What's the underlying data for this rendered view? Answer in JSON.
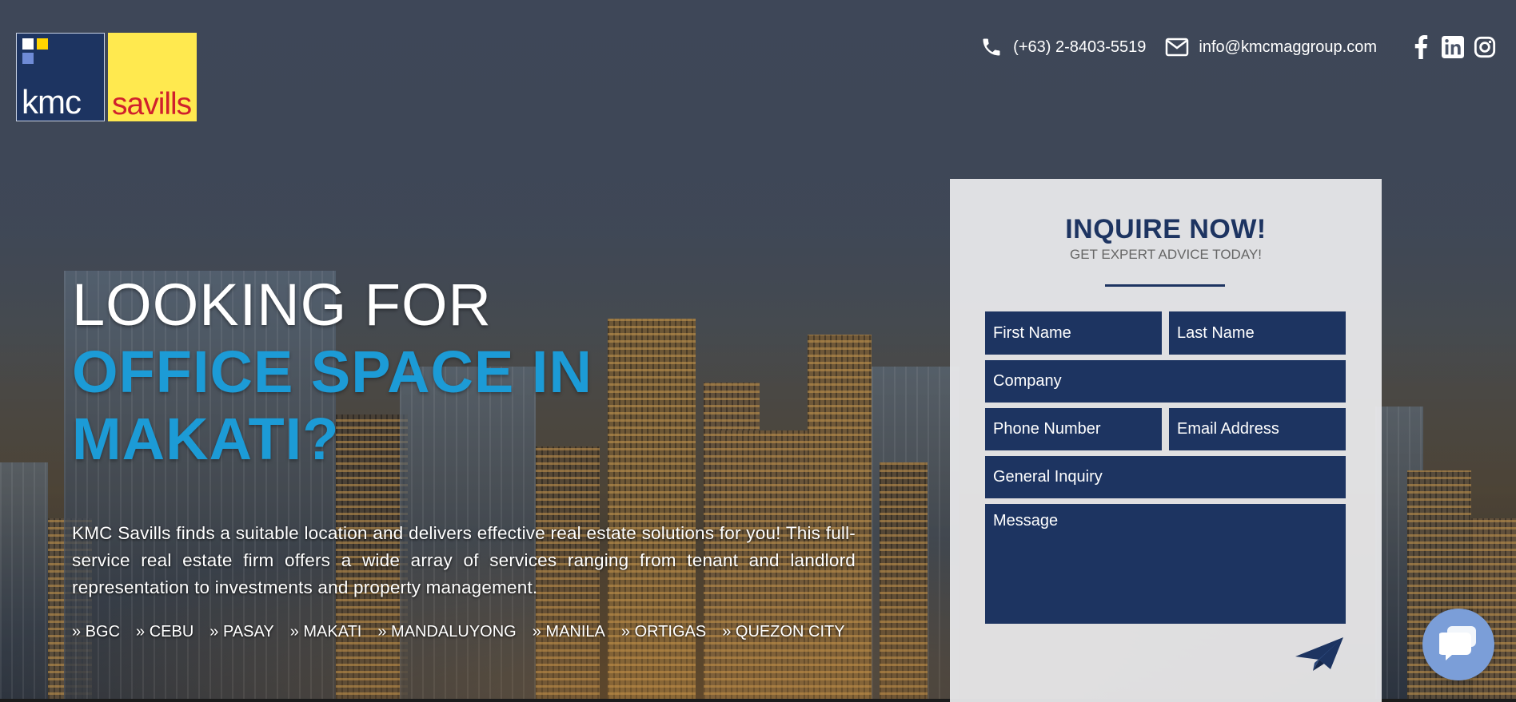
{
  "logo": {
    "kmc_text": "kmc",
    "savills_text": "savills"
  },
  "header": {
    "phone": "(+63) 2-8403-5519",
    "email": "info@kmcmaggroup.com",
    "social_icons": [
      "facebook-icon",
      "linkedin-icon",
      "instagram-icon"
    ]
  },
  "hero": {
    "line1": "LOOKING FOR",
    "line2a": "OFFICE SPACE IN",
    "line2b": "MAKATI?",
    "description": "KMC Savills finds a suitable location and delivers effective real estate solutions for you! This full-service real estate firm offers a wide array of services ranging from tenant and landlord representation to investments and property management.",
    "locations": [
      "» BGC",
      "» CEBU",
      "» PASAY",
      "» MAKATI",
      "» MANDALUYONG",
      "» MANILA",
      "» ORTIGAS",
      "» QUEZON CITY"
    ]
  },
  "form": {
    "title": "INQUIRE NOW!",
    "subtitle": "GET EXPERT ADVICE TODAY!",
    "first_name": "First Name",
    "last_name": "Last Name",
    "company": "Company",
    "phone_number": "Phone Number",
    "email_address": "Email Address",
    "inquiry_type": "General Inquiry",
    "message": "Message"
  },
  "colors": {
    "brand_navy": "#1d3461",
    "accent_blue": "#1c9bd6",
    "savills_yellow": "#ffe94f",
    "savills_red": "#d0202c",
    "chat_blue": "#7b9ed8"
  }
}
